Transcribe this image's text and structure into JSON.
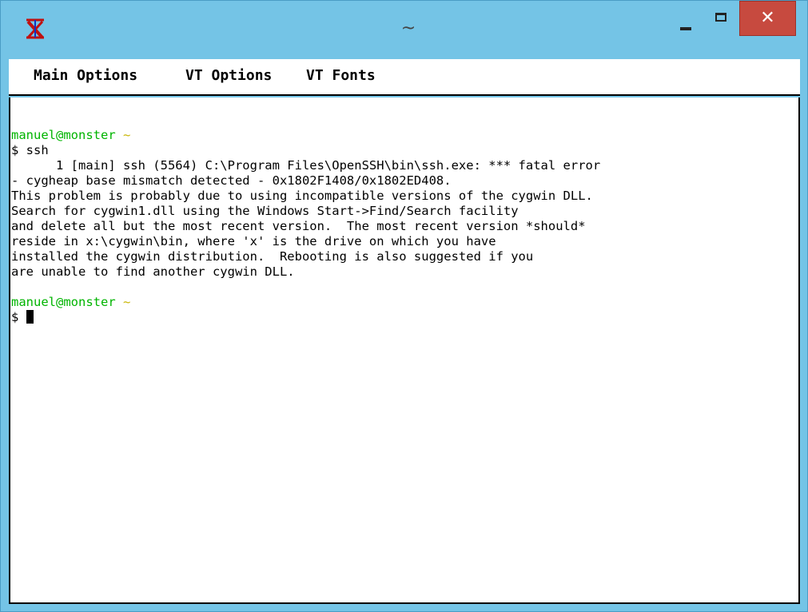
{
  "window": {
    "title": "~",
    "colors": {
      "frame": "#74c4e6",
      "close_button": "#c74a3f",
      "prompt_user": "#00b400",
      "prompt_path": "#c8b400"
    },
    "controls": {
      "minimize_icon": "minimize-icon",
      "maximize_icon": "maximize-icon",
      "close_glyph": "✕"
    }
  },
  "menu": {
    "items": [
      {
        "label": "Main Options"
      },
      {
        "label": "VT Options"
      },
      {
        "label": "VT Fonts"
      }
    ]
  },
  "terminal": {
    "prompt1": {
      "user_host": "manuel@monster",
      "path": "~"
    },
    "command1": "$ ssh",
    "output": [
      "      1 [main] ssh (5564) C:\\Program Files\\OpenSSH\\bin\\ssh.exe: *** fatal error",
      "- cygheap base mismatch detected - 0x1802F1408/0x1802ED408.",
      "This problem is probably due to using incompatible versions of the cygwin DLL.",
      "Search for cygwin1.dll using the Windows Start->Find/Search facility",
      "and delete all but the most recent version.  The most recent version *should*",
      "reside in x:\\cygwin\\bin, where 'x' is the drive on which you have",
      "installed the cygwin distribution.  Rebooting is also suggested if you",
      "are unable to find another cygwin DLL."
    ],
    "prompt2": {
      "user_host": "manuel@monster",
      "path": "~"
    },
    "command2": "$ "
  }
}
